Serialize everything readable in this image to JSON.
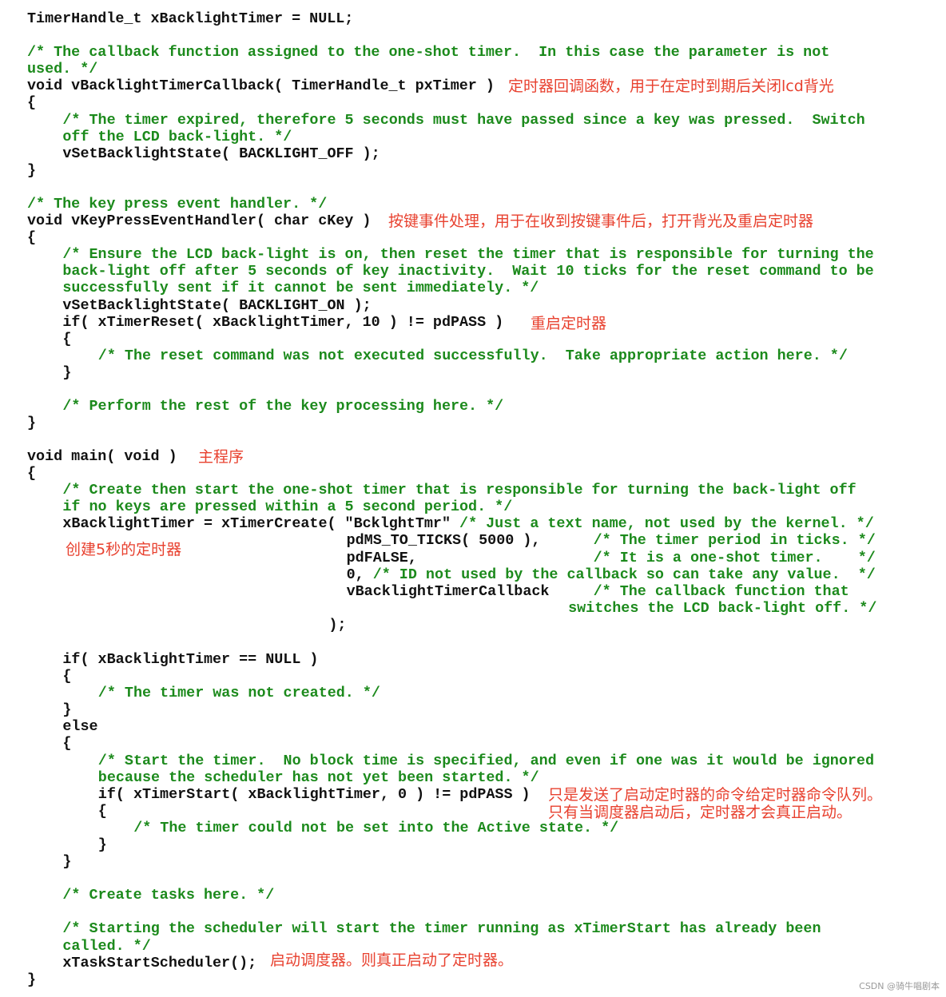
{
  "colors": {
    "code": "#111111",
    "comment": "#1c8a1c",
    "annotation": "#e8412f",
    "watermark": "#9a9a9a"
  },
  "lines": [
    {
      "indent": 0,
      "code": "TimerHandle_t xBacklightTimer = NULL;",
      "comment": ""
    },
    {
      "indent": 0,
      "code": "",
      "comment": "/* The callback function assigned to the one-shot timer.  In this case the parameter is not"
    },
    {
      "indent": 0,
      "code": "",
      "comment": "used. */"
    },
    {
      "indent": 0,
      "code": "void vBacklightTimerCallback( TimerHandle_t pxTimer )",
      "comment": ""
    },
    {
      "indent": 0,
      "code": "{",
      "comment": ""
    },
    {
      "indent": 4,
      "code": "",
      "comment": "/* The timer expired, therefore 5 seconds must have passed since a key was pressed.  Switch"
    },
    {
      "indent": 4,
      "code": "",
      "comment": "off the LCD back-light. */"
    },
    {
      "indent": 4,
      "code": "vSetBacklightState( BACKLIGHT_OFF );",
      "comment": ""
    },
    {
      "indent": 0,
      "code": "}",
      "comment": ""
    },
    {
      "indent": 0,
      "code": "",
      "comment": "/* The key press event handler. */"
    },
    {
      "indent": 0,
      "code": "void vKeyPressEventHandler( char cKey )",
      "comment": ""
    },
    {
      "indent": 0,
      "code": "{",
      "comment": ""
    },
    {
      "indent": 4,
      "code": "",
      "comment": "/* Ensure the LCD back-light is on, then reset the timer that is responsible for turning the"
    },
    {
      "indent": 4,
      "code": "",
      "comment": "back-light off after 5 seconds of key inactivity.  Wait 10 ticks for the reset command to be"
    },
    {
      "indent": 4,
      "code": "",
      "comment": "successfully sent if it cannot be sent immediately. */"
    },
    {
      "indent": 4,
      "code": "vSetBacklightState( BACKLIGHT_ON );",
      "comment": ""
    },
    {
      "indent": 4,
      "code": "if( xTimerReset( xBacklightTimer, 10 ) != pdPASS )",
      "comment": ""
    },
    {
      "indent": 4,
      "code": "{",
      "comment": ""
    },
    {
      "indent": 8,
      "code": "",
      "comment": "/* The reset command was not executed successfully.  Take appropriate action here. */"
    },
    {
      "indent": 4,
      "code": "}",
      "comment": ""
    },
    {
      "indent": 4,
      "code": "",
      "comment": "/* Perform the rest of the key processing here. */"
    },
    {
      "indent": 0,
      "code": "}",
      "comment": ""
    },
    {
      "indent": 0,
      "code": "void main( void )",
      "comment": ""
    },
    {
      "indent": 0,
      "code": "{",
      "comment": ""
    },
    {
      "indent": 4,
      "code": "",
      "comment": "/* Create then start the one-shot timer that is responsible for turning the back-light off"
    },
    {
      "indent": 4,
      "code": "",
      "comment": "if no keys are pressed within a 5 second period. */"
    },
    {
      "indent": 4,
      "code": "xBacklightTimer = xTimerCreate( \"BcklghtTmr\" ",
      "comment": "/* Just a text name, not used by the kernel. */"
    },
    {
      "indent": 36,
      "code": "pdMS_TO_TICKS( 5000 ),      ",
      "comment": "/* The timer period in ticks. */"
    },
    {
      "indent": 36,
      "code": "pdFALSE,                    ",
      "comment": "/* It is a one-shot timer.    */"
    },
    {
      "indent": 36,
      "code": "0, ",
      "comment": "/* ID not used by the callback so can take any value.  */"
    },
    {
      "indent": 36,
      "code": "vBacklightTimerCallback     ",
      "comment": "/* The callback function that"
    },
    {
      "indent": 61,
      "code": "",
      "comment": "switches the LCD back-light off. */"
    },
    {
      "indent": 34,
      "code": ");",
      "comment": ""
    },
    {
      "indent": 4,
      "code": "if( xBacklightTimer == NULL )",
      "comment": ""
    },
    {
      "indent": 4,
      "code": "{",
      "comment": ""
    },
    {
      "indent": 8,
      "code": "",
      "comment": "/* The timer was not created. */"
    },
    {
      "indent": 4,
      "code": "}",
      "comment": ""
    },
    {
      "indent": 4,
      "code": "else",
      "comment": ""
    },
    {
      "indent": 4,
      "code": "{",
      "comment": ""
    },
    {
      "indent": 8,
      "code": "",
      "comment": "/* Start the timer.  No block time is specified, and even if one was it would be ignored"
    },
    {
      "indent": 8,
      "code": "",
      "comment": "because the scheduler has not yet been started. */"
    },
    {
      "indent": 8,
      "code": "if( xTimerStart( xBacklightTimer, 0 ) != pdPASS )",
      "comment": ""
    },
    {
      "indent": 8,
      "code": "{",
      "comment": ""
    },
    {
      "indent": 12,
      "code": "",
      "comment": "/* The timer could not be set into the Active state. */"
    },
    {
      "indent": 8,
      "code": "}",
      "comment": ""
    },
    {
      "indent": 4,
      "code": "}",
      "comment": ""
    },
    {
      "indent": 4,
      "code": "",
      "comment": "/* Create tasks here. */"
    },
    {
      "indent": 4,
      "code": "",
      "comment": "/* Starting the scheduler will start the timer running as xTimerStart has already been"
    },
    {
      "indent": 4,
      "code": "",
      "comment": "called. */"
    },
    {
      "indent": 4,
      "code": "xTaskStartScheduler();",
      "comment": ""
    },
    {
      "indent": 0,
      "code": "}",
      "comment": ""
    }
  ],
  "annotations": {
    "callback": "定时器回调函数，用于在定时到期后关闭lcd背光",
    "key_handler": "按键事件处理，用于在收到按键事件后，打开背光及重启定时器",
    "timer_reset": "重启定时器",
    "main": "主程序",
    "create_timer": "创建5秒的定时器",
    "timer_start_1": "只是发送了启动定时器的命令给定时器命令队列。",
    "timer_start_2": "只有当调度器启动后，定时器才会真正启动。",
    "scheduler": "启动调度器。则真正启动了定时器。"
  },
  "watermark": "CSDN @骑牛唱剧本"
}
